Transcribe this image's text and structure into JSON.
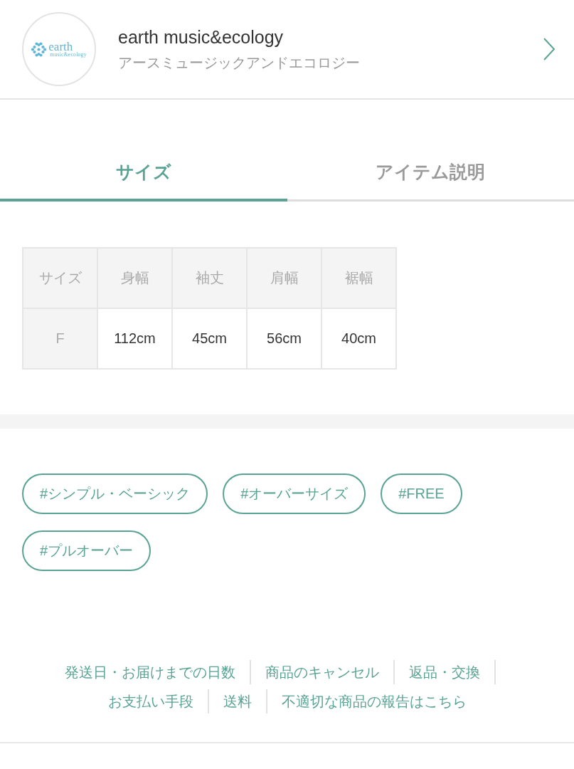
{
  "brand": {
    "logo": {
      "wordmark": "earth",
      "tagline": "music&ecology"
    },
    "name": "earth music&ecology",
    "name_kana": "アースミュージックアンドエコロジー"
  },
  "tabs": [
    {
      "label": "サイズ",
      "selected": true
    },
    {
      "label": "アイテム説明",
      "selected": false
    }
  ],
  "size_table": {
    "columns": [
      "サイズ",
      "身幅",
      "袖丈",
      "肩幅",
      "裾幅"
    ],
    "rows": [
      [
        "F",
        "112cm",
        "45cm",
        "56cm",
        "40cm"
      ]
    ]
  },
  "tags": [
    "#シンプル・ベーシック",
    "#オーバーサイズ",
    "#FREE",
    "#プルオーバー"
  ],
  "footer_links": [
    [
      "発送日・お届けまでの日数",
      "商品のキャンセル",
      "返品・交換"
    ],
    [
      "お支払い手段",
      "送料",
      "不適切な商品の報告はこちら"
    ]
  ]
}
